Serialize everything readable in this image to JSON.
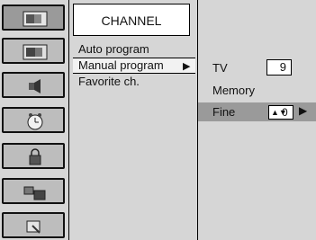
{
  "menu": {
    "title": "CHANNEL",
    "items": [
      {
        "label": "Auto program"
      },
      {
        "label": "Manual program",
        "arrow": "▶"
      },
      {
        "label": "Favorite ch."
      }
    ]
  },
  "submenu": {
    "tv_label": "TV",
    "tv_value": "9",
    "memory_label": "Memory",
    "fine_label": "Fine",
    "fine_value": "0",
    "fine_spin_symbol": "▲▼",
    "fine_arrow": "▶"
  },
  "sidebar": {
    "items": [
      {
        "icon": "tv-screen-icon",
        "active": true
      },
      {
        "icon": "picture-icon",
        "active": false
      },
      {
        "icon": "speaker-icon",
        "active": false
      },
      {
        "icon": "clock-icon",
        "active": false
      },
      {
        "icon": "lock-icon",
        "active": false
      },
      {
        "icon": "screen-layout-icon",
        "active": false
      },
      {
        "icon": "settings-icon",
        "active": false
      }
    ]
  }
}
